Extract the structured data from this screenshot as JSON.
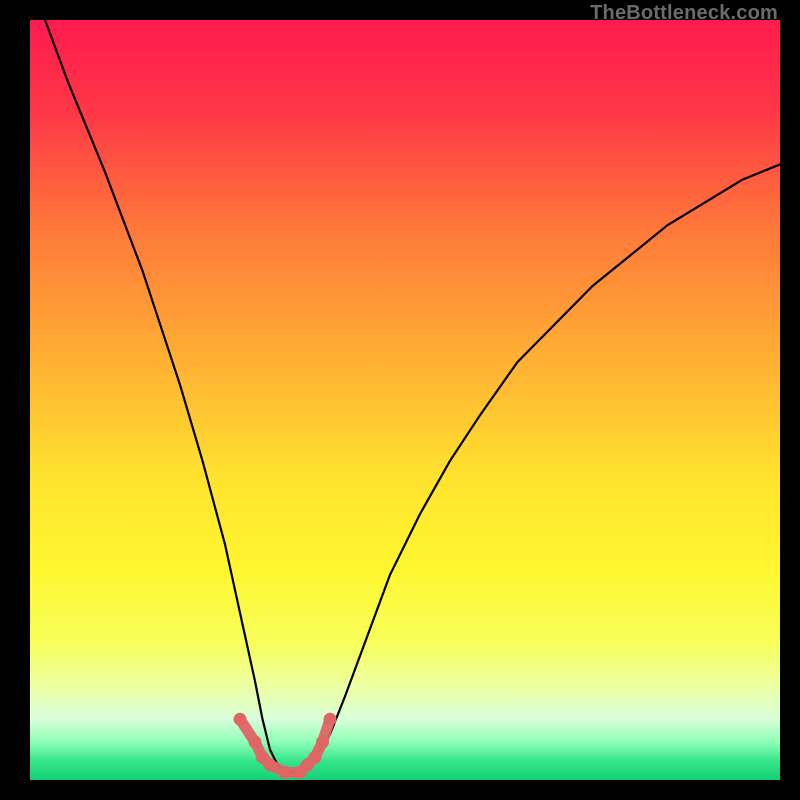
{
  "watermark": "TheBottleneck.com",
  "chart_data": {
    "type": "line",
    "title": "",
    "xlabel": "",
    "ylabel": "",
    "xlim": [
      0,
      100
    ],
    "ylim": [
      0,
      100
    ],
    "x": [
      2,
      5,
      10,
      15,
      20,
      23,
      26,
      28,
      30,
      31,
      32,
      33,
      34,
      35,
      36,
      37,
      38,
      40,
      42,
      45,
      48,
      52,
      56,
      60,
      65,
      70,
      75,
      80,
      85,
      90,
      95,
      100
    ],
    "y": [
      100,
      92,
      80,
      67,
      52,
      42,
      31,
      22,
      13,
      8,
      4,
      2,
      1,
      1,
      1,
      2,
      3,
      6,
      11,
      19,
      27,
      35,
      42,
      48,
      55,
      60,
      65,
      69,
      73,
      76,
      79,
      81
    ],
    "marker_points": {
      "x": [
        28,
        30,
        31,
        32,
        34,
        36,
        37,
        38,
        39,
        40
      ],
      "y": [
        8,
        5,
        3,
        2,
        1,
        1,
        2,
        3,
        5,
        8
      ]
    },
    "gradient_stops": [
      {
        "offset": 0.0,
        "color": "#ff1a4f"
      },
      {
        "offset": 0.12,
        "color": "#ff3747"
      },
      {
        "offset": 0.28,
        "color": "#ff7a3a"
      },
      {
        "offset": 0.45,
        "color": "#ffb133"
      },
      {
        "offset": 0.6,
        "color": "#ffe22e"
      },
      {
        "offset": 0.72,
        "color": "#fff62f"
      },
      {
        "offset": 0.82,
        "color": "#f7ff5a"
      },
      {
        "offset": 0.88,
        "color": "#ecffa8"
      },
      {
        "offset": 0.92,
        "color": "#d8ffda"
      },
      {
        "offset": 0.95,
        "color": "#8effb6"
      },
      {
        "offset": 0.975,
        "color": "#37e58a"
      },
      {
        "offset": 1.0,
        "color": "#15d077"
      }
    ],
    "curve_color": "#000000",
    "marker_color": "#e06666"
  }
}
